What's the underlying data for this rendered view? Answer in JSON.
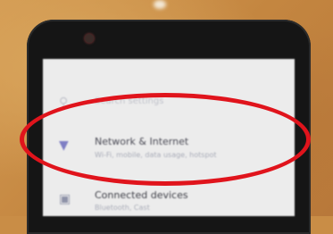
{
  "settings": {
    "items": [
      {
        "id": "search",
        "icon": "search-icon",
        "label": "Search settings",
        "sublabel": ""
      },
      {
        "id": "network",
        "icon": "wifi-icon",
        "label": "Network & Internet",
        "sublabel": "Wi-Fi, mobile, data usage, hotspot"
      },
      {
        "id": "connected",
        "icon": "devices-icon",
        "label": "Connected devices",
        "sublabel": "Bluetooth, Cast"
      }
    ]
  },
  "annotation": {
    "shape": "ellipse",
    "color": "#e0141c",
    "target": "Network & Internet"
  },
  "colors": {
    "background": "#c98d46",
    "phone_body": "#151515",
    "screen": "#ececec",
    "accent_icon": "#7e7ec4"
  }
}
